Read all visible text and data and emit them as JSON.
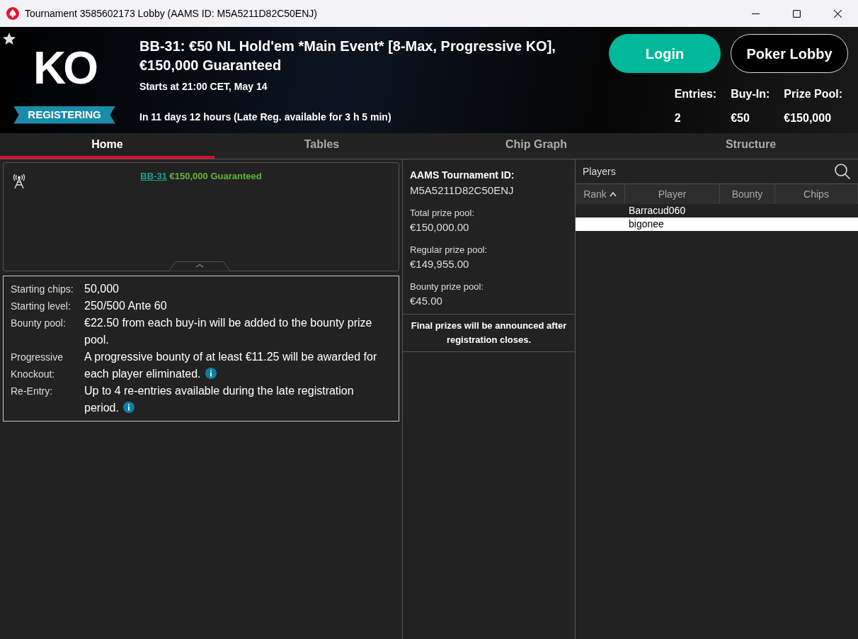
{
  "window": {
    "title": "Tournament 3585602173 Lobby (AAMS ID: M5A5211D82C50ENJ)"
  },
  "header": {
    "logo_text": "KO",
    "status_badge": "REGISTERING",
    "title": "BB-31: €50 NL Hold'em *Main Event* [8-Max, Progressive KO], €150,000 Guaranteed",
    "start_time": "Starts at 21:00 CET, May 14",
    "countdown": "In 11 days 12 hours (Late Reg. available for 3 h 5 min)",
    "buttons": [
      {
        "label": "Login",
        "kind": "primary"
      },
      {
        "label": "Poker Lobby",
        "kind": "outline"
      }
    ],
    "stats": [
      {
        "label": "Entries:",
        "value": "2"
      },
      {
        "label": "Buy-In:",
        "value": "€50"
      },
      {
        "label": "Prize Pool:",
        "value": "€150,000"
      }
    ]
  },
  "tabs": [
    {
      "label": "Home",
      "selected": true
    },
    {
      "label": "Tables",
      "selected": false
    },
    {
      "label": "Chip Graph",
      "selected": false
    },
    {
      "label": "Structure",
      "selected": false
    }
  ],
  "news": {
    "link": "BB-31",
    "headline": "€150,000 Guaranteed"
  },
  "details": [
    {
      "label": "Starting chips:",
      "value": "50,000",
      "info": false
    },
    {
      "label": "Starting level:",
      "value": "250/500 Ante 60",
      "info": false
    },
    {
      "label": "Bounty pool:",
      "value": "€22.50 from each buy-in will be added to the bounty prize pool.",
      "info": false
    },
    {
      "label": "Progressive Knockout:",
      "value": "A progressive bounty of at least €11.25 will be awarded for each player eliminated.",
      "info": true
    },
    {
      "label": "Re-Entry:",
      "value": "Up to 4 re-entries available during the late registration period.",
      "info": true
    }
  ],
  "prizes": {
    "id_label": "AAMS Tournament ID:",
    "id_value": "M5A5211D82C50ENJ",
    "pools": [
      {
        "label": "Total prize pool:",
        "value": "€150,000.00"
      },
      {
        "label": "Regular prize pool:",
        "value": "€149,955.00"
      },
      {
        "label": "Bounty prize pool:",
        "value": "€45.00"
      }
    ],
    "note": "Final prizes will be announced after registration closes."
  },
  "players": {
    "title": "Players",
    "columns": [
      {
        "label": "Rank",
        "sorted": true
      },
      {
        "label": "Player",
        "sorted": false
      },
      {
        "label": "Bounty",
        "sorted": false
      },
      {
        "label": "Chips",
        "sorted": false
      }
    ],
    "rows": [
      {
        "player": "Barracud060",
        "selected": false
      },
      {
        "player": "bigonee",
        "selected": true
      }
    ]
  }
}
